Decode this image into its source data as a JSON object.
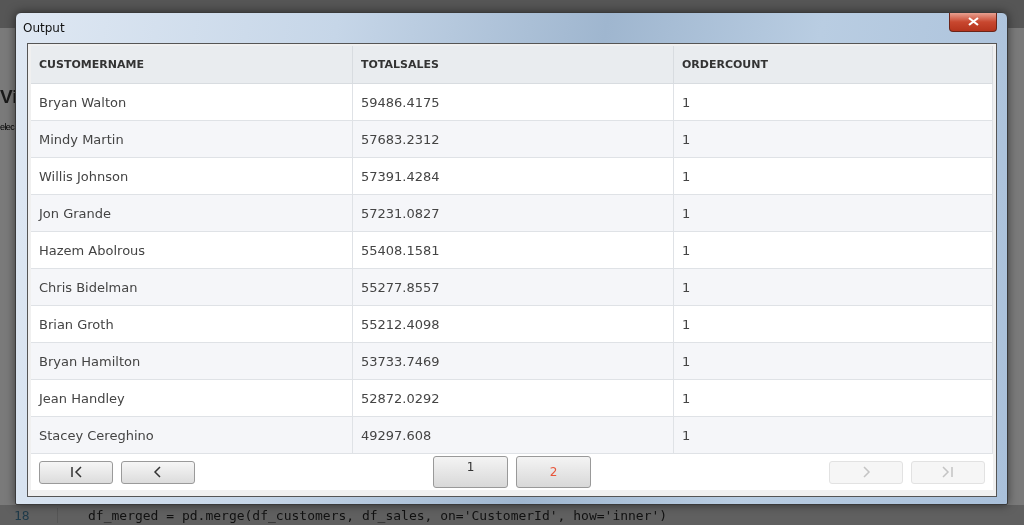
{
  "background": {
    "heading": "Vi",
    "subtitle": "elec",
    "code_line": {
      "number": "18",
      "code": "df_merged = pd.merge(df_customers, df_sales, on='CustomerId', how='inner')"
    }
  },
  "dialog": {
    "title": "Output",
    "table": {
      "columns": [
        "CUSTOMERNAME",
        "TOTALSALES",
        "ORDERCOUNT"
      ],
      "rows": [
        [
          "Bryan Walton",
          "59486.4175",
          "1"
        ],
        [
          "Mindy Martin",
          "57683.2312",
          "1"
        ],
        [
          "Willis Johnson",
          "57391.4284",
          "1"
        ],
        [
          "Jon Grande",
          "57231.0827",
          "1"
        ],
        [
          "Hazem Abolrous",
          "55408.1581",
          "1"
        ],
        [
          "Chris Bidelman",
          "55277.8557",
          "1"
        ],
        [
          "Brian Groth",
          "55212.4098",
          "1"
        ],
        [
          "Bryan Hamilton",
          "53733.7469",
          "1"
        ],
        [
          "Jean Handley",
          "52872.0292",
          "1"
        ],
        [
          "Stacey Cereghino",
          "49297.608",
          "1"
        ]
      ]
    },
    "pagination": {
      "nav": [
        {
          "kind": "first",
          "disabled": false
        },
        {
          "kind": "prev",
          "disabled": false
        },
        {
          "kind": "next",
          "disabled": true
        },
        {
          "kind": "last",
          "disabled": true
        }
      ],
      "pages": [
        {
          "label": "1",
          "selected": false
        },
        {
          "label": "2",
          "selected": true
        }
      ]
    }
  }
}
